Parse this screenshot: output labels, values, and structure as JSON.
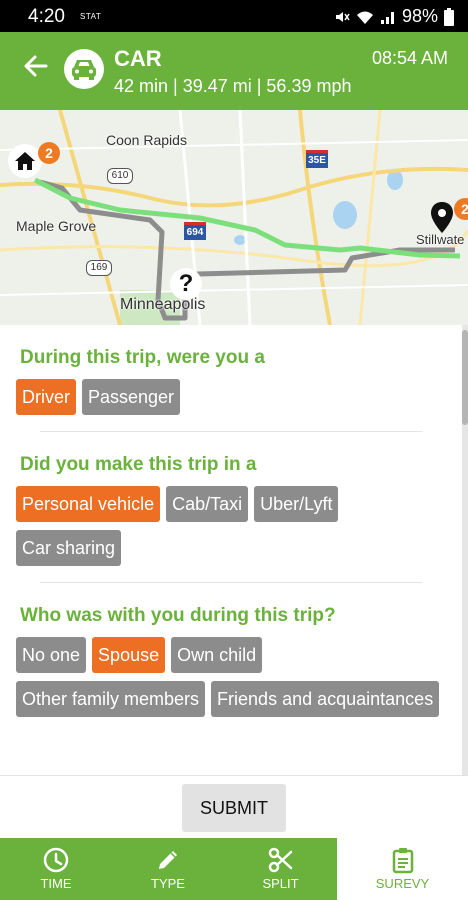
{
  "status_bar": {
    "time": "4:20",
    "carrier": "STAT",
    "battery": "98%"
  },
  "header": {
    "mode": "CAR",
    "stats": "42 min | 39.47 mi | 56.39 mph",
    "clock": "08:54 AM"
  },
  "map": {
    "labels": {
      "coon_rapids": "Coon Rapids",
      "maple_grove": "Maple Grove",
      "minneapolis": "Minneapolis",
      "stillwater": "Stillwate"
    },
    "highways": {
      "h610": "610",
      "h35e": "35E",
      "h694": "694",
      "h169": "169"
    },
    "origin_badge": "2",
    "destination_badge": "2",
    "unknown_marker": "?"
  },
  "survey": {
    "q1": {
      "label": "During this trip, were you a",
      "options": [
        "Driver",
        "Passenger"
      ]
    },
    "q2": {
      "label": "Did you make this trip in a",
      "options": [
        "Personal vehicle",
        "Cab/Taxi",
        "Uber/Lyft",
        "Car sharing"
      ]
    },
    "q3": {
      "label": "Who was with you during this trip?",
      "options": [
        "No one",
        "Spouse",
        "Own child",
        "Other family members",
        "Friends and acquaintances"
      ]
    }
  },
  "submit_label": "SUBMIT",
  "nav": {
    "time": "TIME",
    "type": "TYPE",
    "split": "SPLIT",
    "survey": "SUREVY"
  },
  "colors": {
    "brand_green": "#6ab23c",
    "selected_orange": "#ec6f23",
    "unselected_gray": "#8c8c8c",
    "route_green": "#7be07b",
    "route_gray": "#8d8d8d"
  },
  "icons": {
    "back": "arrow-left-icon",
    "mode": "car-icon",
    "origin": "home-icon",
    "destination": "location-pin-icon",
    "time": "clock-icon",
    "type": "pencil-icon",
    "split": "scissors-icon",
    "survey": "clipboard-icon"
  }
}
